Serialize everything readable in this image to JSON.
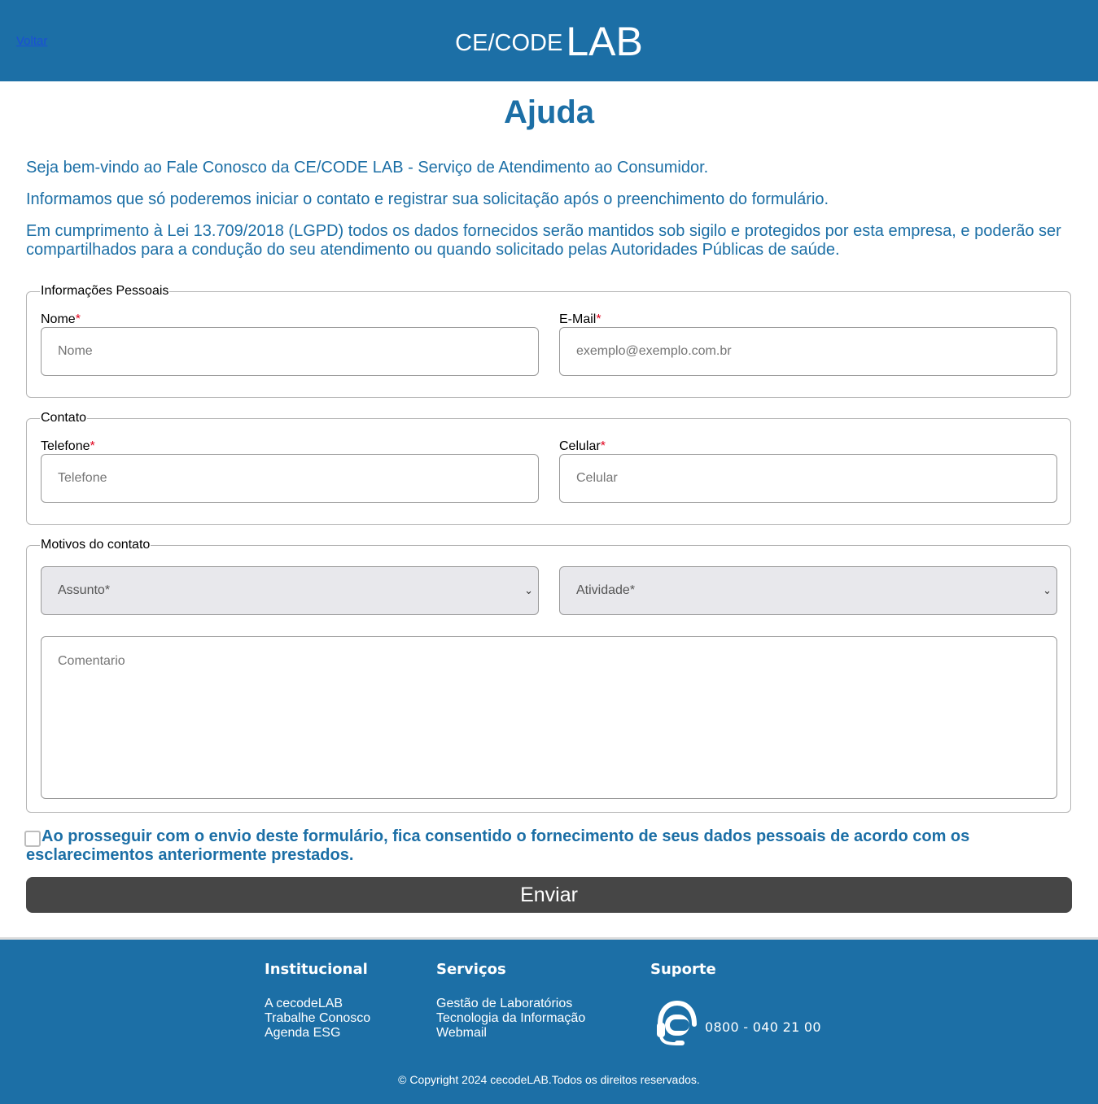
{
  "header": {
    "back_link": "Voltar",
    "logo_part1": "CE/CODE",
    "logo_part2": "LAB"
  },
  "page_title": "Ajuda",
  "intro": {
    "p1": "Seja bem-vindo ao Fale Conosco da CE/CODE LAB - Serviço de Atendimento ao Consumidor.",
    "p2": "Informamos que só poderemos iniciar o contato e registrar sua solicitação após o preenchimento do formulário.",
    "p3": "Em cumprimento à Lei 13.709/2018 (LGPD) todos os dados fornecidos serão mantidos sob sigilo e protegidos por esta empresa, e poderão ser compartilhados para a condução do seu atendimento ou quando solicitado pelas Autoridades Públicas de saúde."
  },
  "form": {
    "required_mark": "*",
    "personal": {
      "legend": "Informações Pessoais",
      "name_label": "Nome",
      "name_placeholder": "Nome",
      "email_label": "E-Mail",
      "email_placeholder": "exemplo@exemplo.com.br"
    },
    "contact": {
      "legend": "Contato",
      "phone_label": "Telefone",
      "phone_placeholder": "Telefone",
      "mobile_label": "Celular",
      "mobile_placeholder": "Celular"
    },
    "reasons": {
      "legend": "Motivos do contato",
      "subject_selected": "Assunto*",
      "activity_selected": "Atividade*",
      "comment_placeholder": "Comentario"
    },
    "consent_text": "Ao prosseguir com o envio deste formulário, fica consentido o fornecimento de seus dados pessoais de acordo com os esclarecimentos anteriormente prestados.",
    "consent_checked": false,
    "submit_label": "Enviar"
  },
  "footer": {
    "institucional": {
      "title": "Institucional",
      "links": [
        "A cecodeLAB",
        "Trabalhe Conosco",
        "Agenda ESG"
      ]
    },
    "servicos": {
      "title": "Serviços",
      "links": [
        "Gestão de Laboratórios",
        "Tecnologia da Informação",
        "Webmail"
      ]
    },
    "suporte": {
      "title": "Suporte",
      "icon": "headset-icon",
      "phone": "0800 - 040 21 00"
    },
    "copyright": "© Copyright 2024 cecodeLAB.Todos os direitos reservados."
  },
  "colors": {
    "brand_blue": "#1c6fa6",
    "button_dark": "#464646",
    "required_red": "#e0001b",
    "link_blue": "#1a4fd6"
  }
}
